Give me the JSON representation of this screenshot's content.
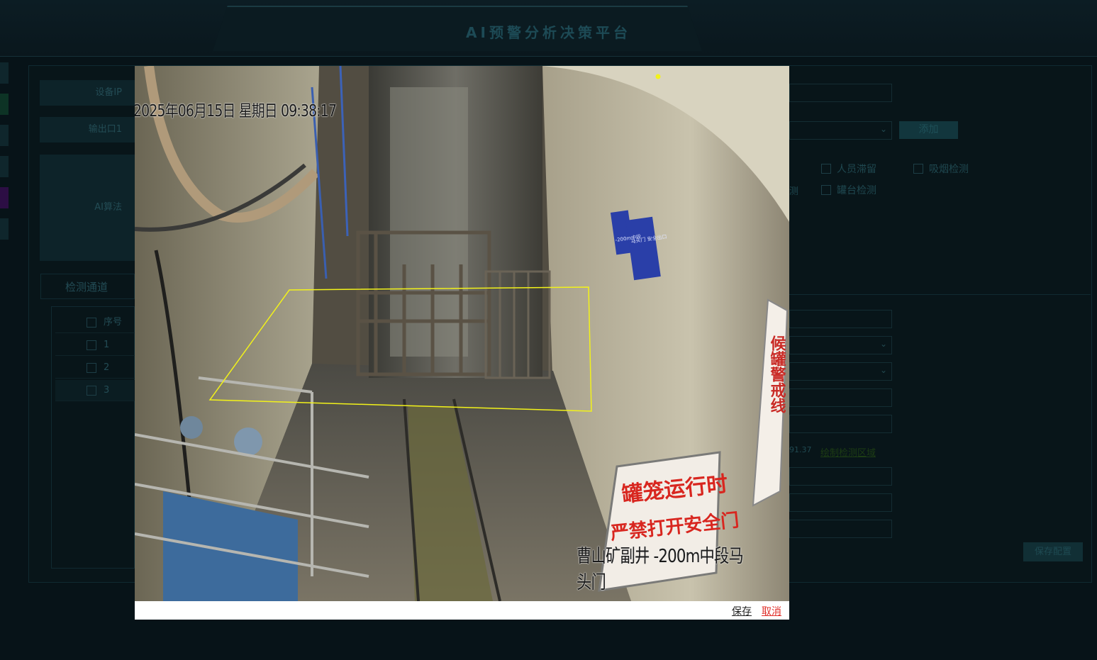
{
  "app": {
    "title": "AI预警分析决策平台"
  },
  "form": {
    "device_ip_label": "设备IP",
    "output_label": "输出口1",
    "ai_algorithm_label": "AI算法",
    "add_button": "添加",
    "algorithms": [
      {
        "label": "人员滞留",
        "checked": false
      },
      {
        "label": "吸烟检测",
        "checked": false
      },
      {
        "label": "罐台检测",
        "checked": false
      }
    ],
    "stray_text": "测",
    "ip_tail": "91.37",
    "region_link": "绘制检测区域",
    "save_config_button": "保存配置"
  },
  "channels": {
    "title": "检测通道",
    "header": "序号",
    "rows": [
      "1",
      "2",
      "3"
    ],
    "selected_row": "3"
  },
  "modal": {
    "osd_timestamp": "2025年06月15日 星期日 09:38:17",
    "osd_location": "曹山矿副井 -200m中段马头门",
    "sign_cage_line1": "罐笼运行时",
    "sign_cage_line2": "严禁打开安全门",
    "sign_vertical": "候罐警戒线",
    "wall_sign_1": "-200m中段",
    "wall_sign_2": "马头门 安全出口",
    "save_label": "保存",
    "cancel_label": "取消",
    "region_color": "#f2f21a"
  },
  "colors": {
    "background": "#071318",
    "modal_background": "#ffffff",
    "cancel": "#e0302a"
  }
}
